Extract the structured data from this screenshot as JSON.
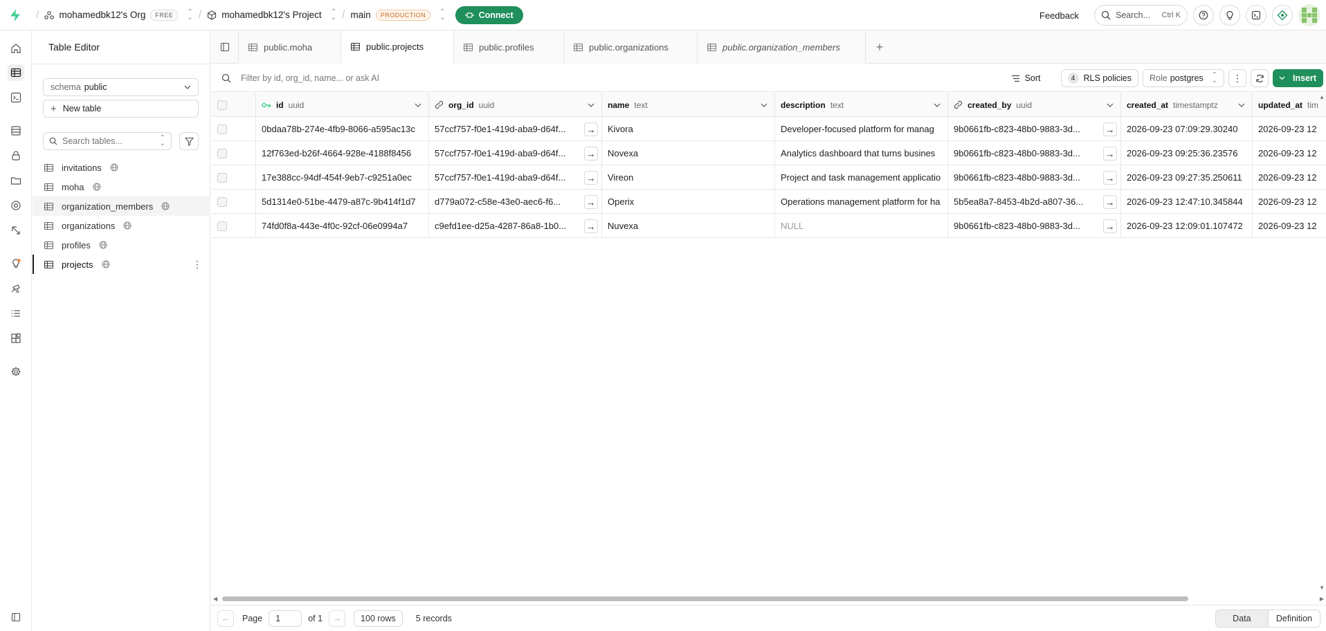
{
  "topbar": {
    "org_name": "mohamedbk12's Org",
    "org_plan": "FREE",
    "project_name": "mohamedbk12's Project",
    "branch_name": "main",
    "branch_badge": "PRODUCTION",
    "connect_label": "Connect",
    "feedback_label": "Feedback",
    "search_placeholder": "Search...",
    "search_shortcut": "Ctrl K",
    "accent_color": "#1f8f5c"
  },
  "rail": {
    "icons": [
      "home-icon",
      "table-editor-icon",
      "sql-editor-icon",
      "database-icon",
      "auth-icon",
      "storage-icon",
      "realtime-icon",
      "edge-functions-icon",
      "advisors-icon",
      "reports-icon",
      "logs-icon",
      "integrations-icon",
      "settings-icon",
      "collapse-sidebar-icon"
    ]
  },
  "sidebar": {
    "title": "Table Editor",
    "schema_label": "schema",
    "schema_value": "public",
    "new_table_label": "New table",
    "search_placeholder": "Search tables...",
    "tables": [
      {
        "name": "invitations"
      },
      {
        "name": "moha"
      },
      {
        "name": "organization_members"
      },
      {
        "name": "organizations"
      },
      {
        "name": "profiles"
      },
      {
        "name": "projects"
      }
    ]
  },
  "tabs": [
    {
      "label": "public.moha"
    },
    {
      "label": "public.projects"
    },
    {
      "label": "public.profiles"
    },
    {
      "label": "public.organizations"
    },
    {
      "label": "public.organization_members"
    }
  ],
  "toolbar": {
    "filter_placeholder": "Filter by id, org_id, name... or ask AI",
    "sort_label": "Sort",
    "rls_count": "4",
    "rls_label": "RLS policies",
    "role_label": "Role",
    "role_value": "postgres",
    "insert_label": "Insert"
  },
  "columns": [
    {
      "name": "id",
      "type": "uuid"
    },
    {
      "name": "org_id",
      "type": "uuid"
    },
    {
      "name": "name",
      "type": "text"
    },
    {
      "name": "description",
      "type": "text"
    },
    {
      "name": "created_by",
      "type": "uuid"
    },
    {
      "name": "created_at",
      "type": "timestamptz"
    },
    {
      "name": "updated_at",
      "type": "tim"
    }
  ],
  "rows": [
    {
      "id": "0bdaa78b-274e-4fb9-8066-a595ac13c",
      "org_id": "57ccf757-f0e1-419d-aba9-d64f...",
      "name": "Kivora",
      "description": "Developer-focused platform for manag",
      "created_by": "9b0661fb-c823-48b0-9883-3d...",
      "created_at": "2026-09-23 07:09:29.30240",
      "updated_at": "2026-09-23 12"
    },
    {
      "id": "12f763ed-b26f-4664-928e-4188f8456",
      "org_id": "57ccf757-f0e1-419d-aba9-d64f...",
      "name": "Novexa",
      "description": "Analytics dashboard that turns busines",
      "created_by": "9b0661fb-c823-48b0-9883-3d...",
      "created_at": "2026-09-23 09:25:36.23576",
      "updated_at": "2026-09-23 12"
    },
    {
      "id": "17e388cc-94df-454f-9eb7-c9251a0ec",
      "org_id": "57ccf757-f0e1-419d-aba9-d64f...",
      "name": "Vireon",
      "description": "Project and task management applicatio",
      "created_by": "9b0661fb-c823-48b0-9883-3d...",
      "created_at": "2026-09-23 09:27:35.250611",
      "updated_at": "2026-09-23 12"
    },
    {
      "id": "5d1314e0-51be-4479-a87c-9b414f1d7",
      "org_id": "d779a072-c58e-43e0-aec6-f6...",
      "name": "Operix",
      "description": "Operations management platform for ha",
      "created_by": "5b5ea8a7-8453-4b2d-a807-36...",
      "created_at": "2026-09-23 12:47:10.345844",
      "updated_at": "2026-09-23 12"
    },
    {
      "id": "74fd0f8a-443e-4f0c-92cf-06e0994a7",
      "org_id": "c9efd1ee-d25a-4287-86a8-1b0...",
      "name": "Nuvexa",
      "description": "NULL",
      "created_by": "9b0661fb-c823-48b0-9883-3d...",
      "created_at": "2026-09-23 12:09:01.107472",
      "updated_at": "2026-09-23 12"
    }
  ],
  "footer": {
    "page_label": "Page",
    "page_value": "1",
    "of_label": "of 1",
    "rows_label": "100 rows",
    "records_label": "5 records",
    "view_data": "Data",
    "view_definition": "Definition"
  }
}
